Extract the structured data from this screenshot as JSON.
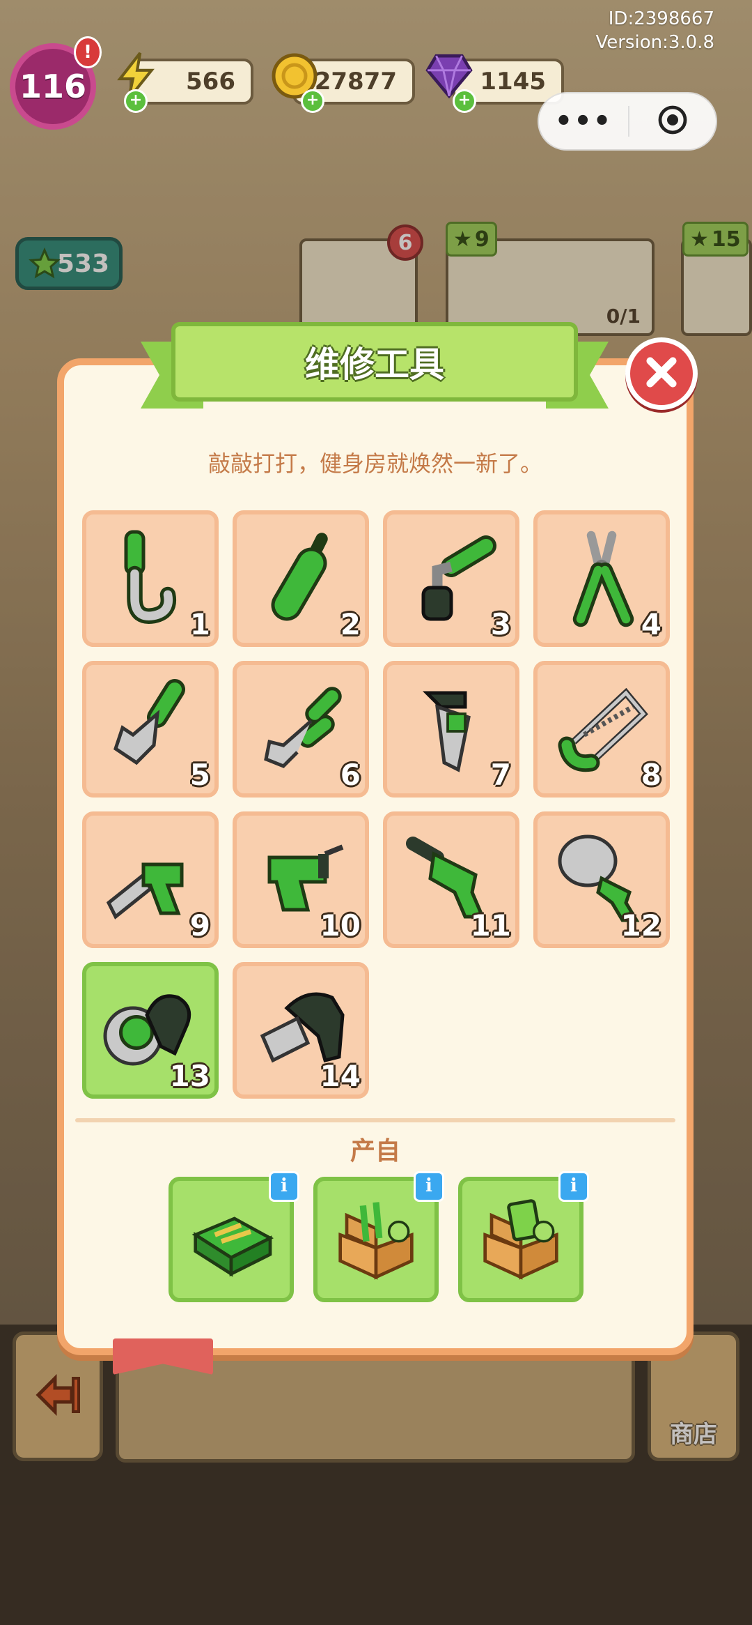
{
  "header": {
    "id_text": "ID:2398667",
    "version_text": "Version:3.0.8",
    "level": "116",
    "level_alert": "!",
    "energy": "566",
    "coins": "27877",
    "gems": "1145",
    "menu_dots": "•••"
  },
  "background": {
    "worker_count": "533",
    "card_badge": "6",
    "card_star_1": "9",
    "card_star_2": "15",
    "card_progress": "0/1",
    "shop_label": "商店"
  },
  "modal": {
    "title": "维修工具",
    "subtitle": "敲敲打打，健身房就焕然一新了。",
    "items": [
      {
        "num": "1",
        "icon": "hook-tool-icon",
        "active": false
      },
      {
        "num": "2",
        "icon": "screwdriver-icon",
        "active": false
      },
      {
        "num": "3",
        "icon": "socket-wrench-icon",
        "active": false
      },
      {
        "num": "4",
        "icon": "pliers-icon",
        "active": false
      },
      {
        "num": "5",
        "icon": "adjustable-wrench-icon",
        "active": false
      },
      {
        "num": "6",
        "icon": "long-wrench-icon",
        "active": false
      },
      {
        "num": "7",
        "icon": "pipe-wrench-icon",
        "active": false
      },
      {
        "num": "8",
        "icon": "hacksaw-icon",
        "active": false
      },
      {
        "num": "9",
        "icon": "saw-drill-icon",
        "active": false
      },
      {
        "num": "10",
        "icon": "power-drill-icon",
        "active": false
      },
      {
        "num": "11",
        "icon": "hammer-drill-icon",
        "active": false
      },
      {
        "num": "12",
        "icon": "core-drill-icon",
        "active": false
      },
      {
        "num": "13",
        "icon": "angle-grinder-icon",
        "active": true
      },
      {
        "num": "14",
        "icon": "impact-driver-icon",
        "active": false
      }
    ],
    "source_label": "产自",
    "sources": [
      {
        "icon": "toolbox-icon",
        "info": "i"
      },
      {
        "icon": "tool-crate-icon",
        "info": "i"
      },
      {
        "icon": "card-crate-icon",
        "info": "i"
      }
    ]
  },
  "colors": {
    "tile_bg": "#f9cfae",
    "tile_active": "#a6e06a",
    "accent_green": "#5bbf3d",
    "close_red": "#e04a4a",
    "modal_border": "#f2a56a"
  }
}
